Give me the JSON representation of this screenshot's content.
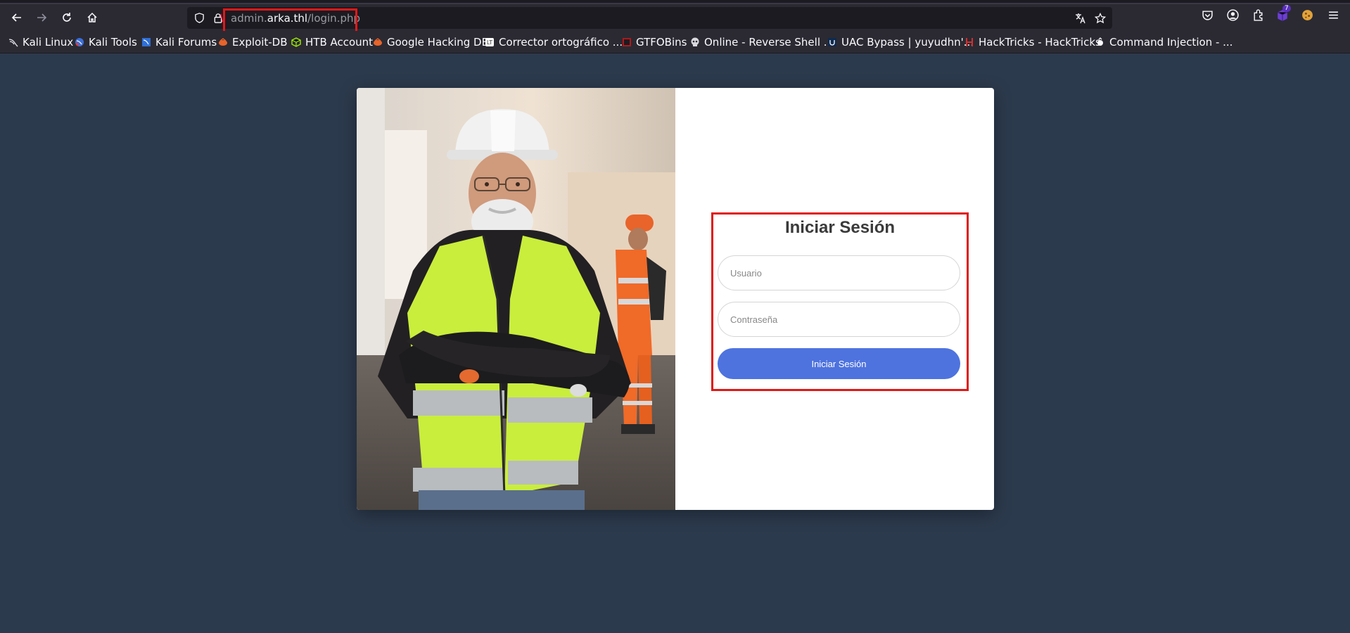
{
  "browser": {
    "url_subdomain": "admin.",
    "url_host": "arka.thl",
    "url_path": "/login.php",
    "extension_badge": "7",
    "bookmarks": [
      {
        "label": "Kali Linux",
        "icon": "kali-icon"
      },
      {
        "label": "Kali Tools",
        "icon": "kali-tools-icon"
      },
      {
        "label": "Kali Forums",
        "icon": "kali-forums-icon"
      },
      {
        "label": "Exploit-DB",
        "icon": "exploit-db-icon"
      },
      {
        "label": "HTB Account",
        "icon": "htb-icon"
      },
      {
        "label": "Google Hacking DB",
        "icon": "ghdb-icon"
      },
      {
        "label": "Corrector ortográfico ...",
        "icon": "corrector-icon"
      },
      {
        "label": "GTFOBins",
        "icon": "gtfobins-icon"
      },
      {
        "label": "Online - Reverse Shell ...",
        "icon": "skull-icon"
      },
      {
        "label": "UAC Bypass | yuyudhn'...",
        "icon": "uac-icon"
      },
      {
        "label": "HackTricks - HackTricks",
        "icon": "hacktricks-icon"
      },
      {
        "label": "Command Injection - ...",
        "icon": "command-injection-icon"
      }
    ]
  },
  "login": {
    "title": "Iniciar Sesión",
    "username_placeholder": "Usuario",
    "password_placeholder": "Contraseña",
    "submit_label": "Iniciar Sesión"
  },
  "colors": {
    "page_background": "#2c3a4d",
    "button": "#4e73df",
    "highlight": "#e01818"
  }
}
